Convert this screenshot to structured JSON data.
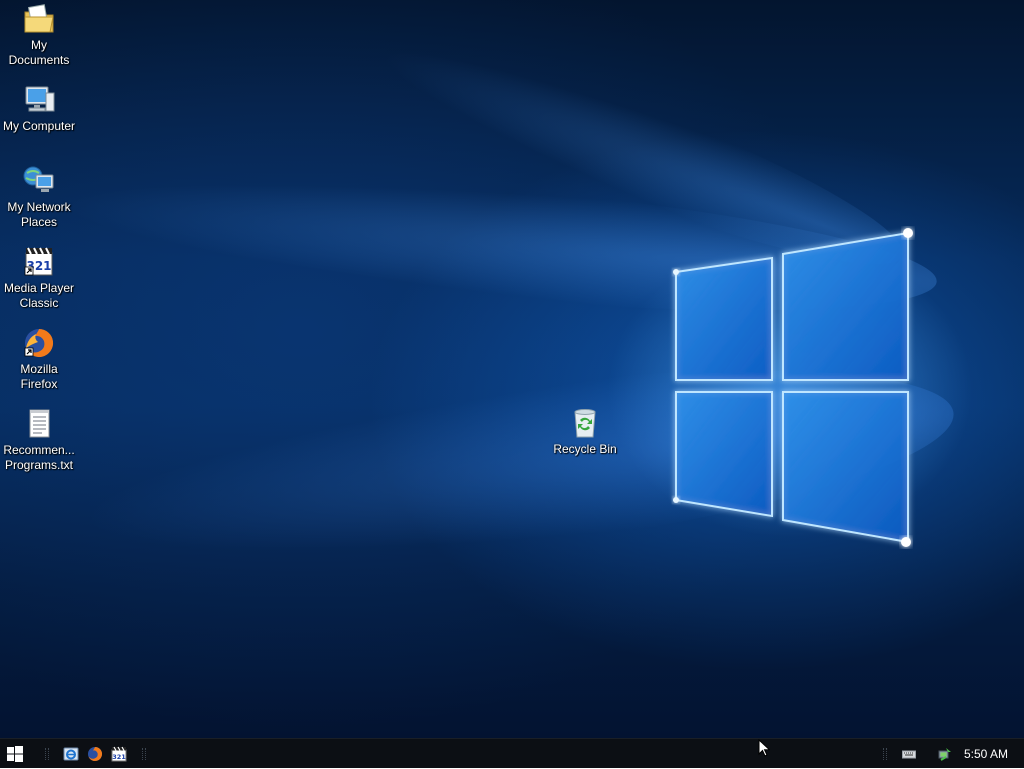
{
  "desktop": {
    "icons": [
      {
        "name": "My Documents",
        "label": "My\nDocuments",
        "icon": "folder-documents-icon"
      },
      {
        "name": "My Computer",
        "label": "My Computer",
        "icon": "computer-icon"
      },
      {
        "name": "My Network Places",
        "label": "My Network\nPlaces",
        "icon": "network-places-icon"
      },
      {
        "name": "Media Player Classic",
        "label": "Media Player\nClassic",
        "icon": "media-player-classic-icon"
      },
      {
        "name": "Mozilla Firefox",
        "label": "Mozilla\nFirefox",
        "icon": "firefox-icon"
      },
      {
        "name": "Recommended Programs",
        "label": "Recommen...\nPrograms.txt",
        "icon": "text-file-icon"
      }
    ],
    "recycle_bin": {
      "label": "Recycle Bin",
      "icon": "recycle-bin-icon"
    }
  },
  "taskbar": {
    "start_icon": "windows-start-icon",
    "quick_launch": [
      {
        "name": "Internet Explorer",
        "icon": "ie-icon"
      },
      {
        "name": "Mozilla Firefox",
        "icon": "firefox-icon"
      },
      {
        "name": "Media Player Classic",
        "icon": "media-player-classic-icon"
      }
    ],
    "tray": {
      "keyboard_icon": "keyboard-icon",
      "network_icon": "network-tray-icon",
      "clock": "5:50 AM"
    }
  },
  "colors": {
    "desktop_bg": "#062a5a",
    "logo_glow": "#5ab4ff",
    "taskbar_bg": "#0c0f14"
  }
}
